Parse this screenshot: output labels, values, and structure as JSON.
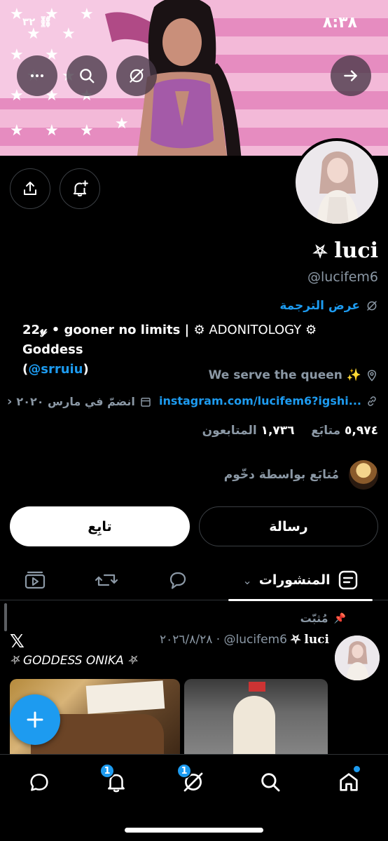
{
  "status_bar": {
    "time": "٨:٣٨",
    "left_indicator": "٣٢"
  },
  "banner": {
    "colors": {
      "stripe_light": "#f3b9d8",
      "stripe_dark": "#e68cc0"
    }
  },
  "profile": {
    "name": "luci",
    "name_symbol": "⛧",
    "handle": "@lucifem6",
    "translate_label": "عرض الترجمة",
    "bio_part1": "22𝓎 • gooner no limits | ",
    "bio_part2": "ADONITOLOGY",
    "bio_part3": "Goddess",
    "bio_mention": "@srruiu",
    "location": "We serve the queen ✨",
    "url": "instagram.com/lucifem6?igshi...",
    "joined": "انضمّ في مارس ٢٠٢٠",
    "following_count": "٥,٩٧٤",
    "following_label": "متابَع",
    "followers_count": "١,٧٣٦",
    "followers_label": "المتابعون",
    "followed_by": "مُتابَع بواسطة دخّوم"
  },
  "actions": {
    "follow_label": "تابِع",
    "message_label": "رسالة"
  },
  "tabs": {
    "posts_label": "المنشورات"
  },
  "tweet": {
    "pinned_label": "مُثبّت",
    "author_name": "luci",
    "author_symbol": "⛧",
    "author_handle": "@lucifem6",
    "date": "٢٠٢٦/٨/٢٨",
    "text": "⛧ GODDESS ONIKA ⛧"
  },
  "nav": {
    "notifications_badge": "1",
    "grok_badge": "1"
  },
  "colors": {
    "accent": "#1d9bf0",
    "background": "#000000",
    "muted": "#8b98a5"
  }
}
